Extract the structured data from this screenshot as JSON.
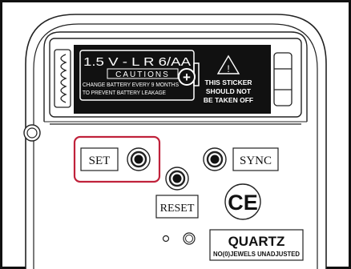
{
  "battery": {
    "spec": "1.5 V - L R 6/AA",
    "cautions": "CAUTIONS",
    "line1": "CHANGE BATTERY EVERY 9 MONTHS",
    "line2": "TO PREVENT BATTERY LEAKAGE",
    "plus": "+"
  },
  "sticker": {
    "warn_symbol": "!",
    "line1": "THIS STICKER",
    "line2": "SHOULD NOT",
    "line3": "BE TAKEN OFF"
  },
  "buttons": {
    "set": "SET",
    "sync": "SYNC",
    "reset": "RESET"
  },
  "ce_mark": "CE",
  "quartz": {
    "title": "QUARTZ",
    "subtitle": "NO(0)JEWELS UNADJUSTED"
  },
  "colors": {
    "highlight": "#c0223b",
    "label_fill": "#111111",
    "outline": "#222222"
  }
}
